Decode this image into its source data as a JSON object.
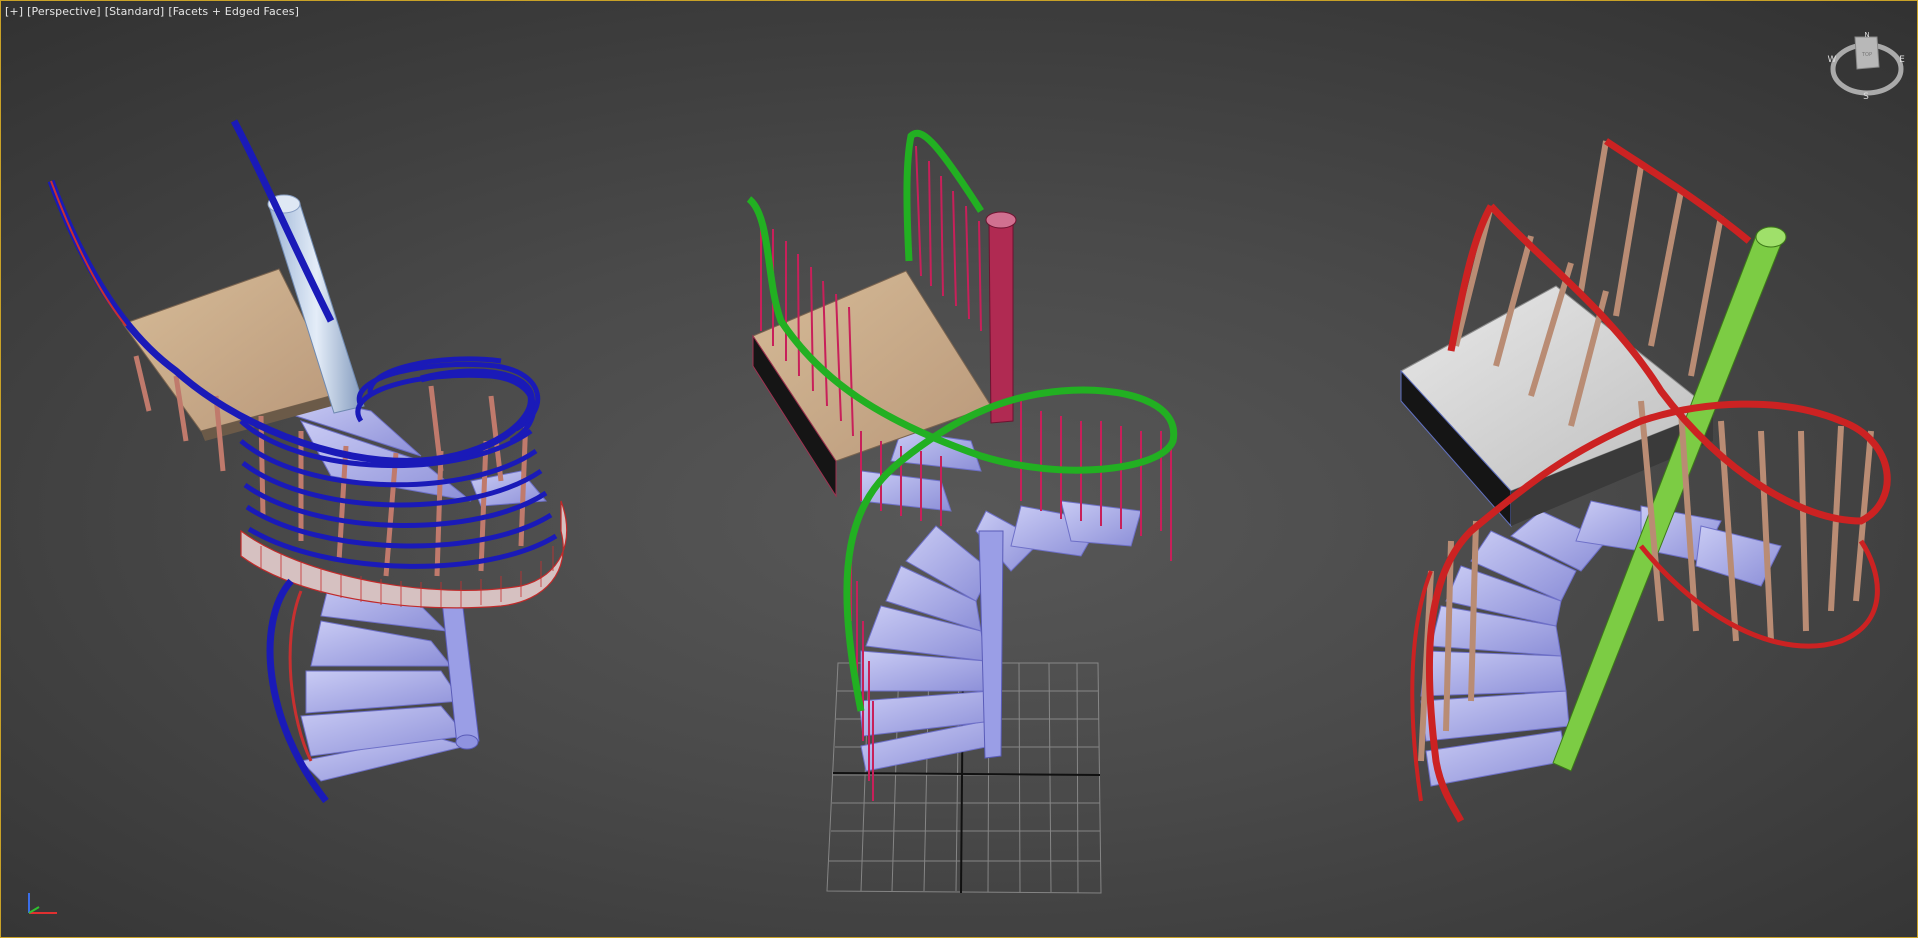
{
  "viewport": {
    "labels": [
      "[+]",
      "[Perspective]",
      "[Standard]",
      "[Facets + Edged Faces]"
    ]
  },
  "viewcube": {
    "compass": {
      "n": "N",
      "w": "W",
      "e": "E",
      "s": "S"
    },
    "face_label": "TOP"
  },
  "colors": {
    "frame": "#c9a227",
    "background_center": "#585858",
    "background_edge": "#303030",
    "blue_railing": "#1a1ab8",
    "green_railing": "#22b022",
    "red_railing": "#cc2222",
    "tread_lavender": "#a3a5e8",
    "wood_landing": "#c8aa86",
    "marble_landing": "#d4d4d4",
    "pink_balusters": "#c8205a",
    "tan_balusters": "#b98c74",
    "pole_light_blue": "#b8cde6",
    "pole_green": "#7ccc44",
    "grid": "#999999"
  }
}
